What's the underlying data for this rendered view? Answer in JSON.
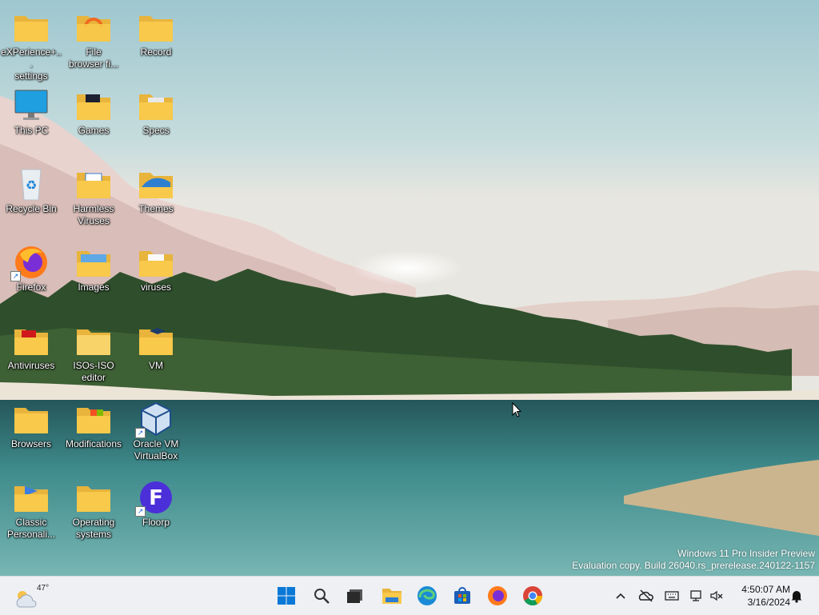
{
  "desktop": {
    "icons": [
      {
        "label": "eXPerience+...\nsettings",
        "icon": "folder-icon"
      },
      {
        "label": "File\nbrowser fi...",
        "icon": "folder-icon"
      },
      {
        "label": "Record",
        "icon": "folder-icon"
      },
      {
        "label": "This PC",
        "icon": "monitor-icon"
      },
      {
        "label": "Games",
        "icon": "folder-icon"
      },
      {
        "label": "Specs",
        "icon": "folder-icon"
      },
      {
        "label": "Recycle Bin",
        "icon": "recycle-bin-icon"
      },
      {
        "label": "Harmless\nViruses",
        "icon": "folder-icon"
      },
      {
        "label": "Themes",
        "icon": "folder-icon"
      },
      {
        "label": "Firefox",
        "icon": "firefox-icon"
      },
      {
        "label": "Images",
        "icon": "folder-icon"
      },
      {
        "label": "viruses",
        "icon": "folder-icon"
      },
      {
        "label": "Antiviruses",
        "icon": "folder-icon"
      },
      {
        "label": "ISOs-ISO\neditor",
        "icon": "folder-icon"
      },
      {
        "label": "VM",
        "icon": "folder-icon"
      },
      {
        "label": "Browsers",
        "icon": "folder-icon"
      },
      {
        "label": "Modifications",
        "icon": "folder-icon"
      },
      {
        "label": "Oracle VM\nVirtualBox",
        "icon": "virtualbox-icon"
      },
      {
        "label": "Classic\nPersonali...",
        "icon": "folder-icon"
      },
      {
        "label": "Operating\nsystems",
        "icon": "folder-icon"
      },
      {
        "label": "Floorp",
        "icon": "floorp-icon"
      }
    ],
    "watermark": {
      "line1": "Windows 11 Pro Insider Preview",
      "line2": "Evaluation copy. Build 26040.rs_prerelease.240122-1157"
    }
  },
  "taskbar": {
    "weather_temp": "47°",
    "pinned": [
      {
        "name": "start-button",
        "icon": "windows-logo-icon"
      },
      {
        "name": "search-button",
        "icon": "search-icon"
      },
      {
        "name": "task-view-button",
        "icon": "task-view-icon"
      },
      {
        "name": "file-explorer-button",
        "icon": "file-explorer-icon"
      },
      {
        "name": "edge-button",
        "icon": "edge-icon"
      },
      {
        "name": "store-button",
        "icon": "store-icon"
      },
      {
        "name": "firefox-button",
        "icon": "firefox-icon"
      },
      {
        "name": "chrome-button",
        "icon": "chrome-icon"
      }
    ],
    "clock": {
      "time": "4:50:07 AM",
      "date": "3/16/2024"
    }
  },
  "colors": {
    "folder": "#f8c94a",
    "taskbar": "#eef0f4",
    "accent": "#0a63d8"
  }
}
